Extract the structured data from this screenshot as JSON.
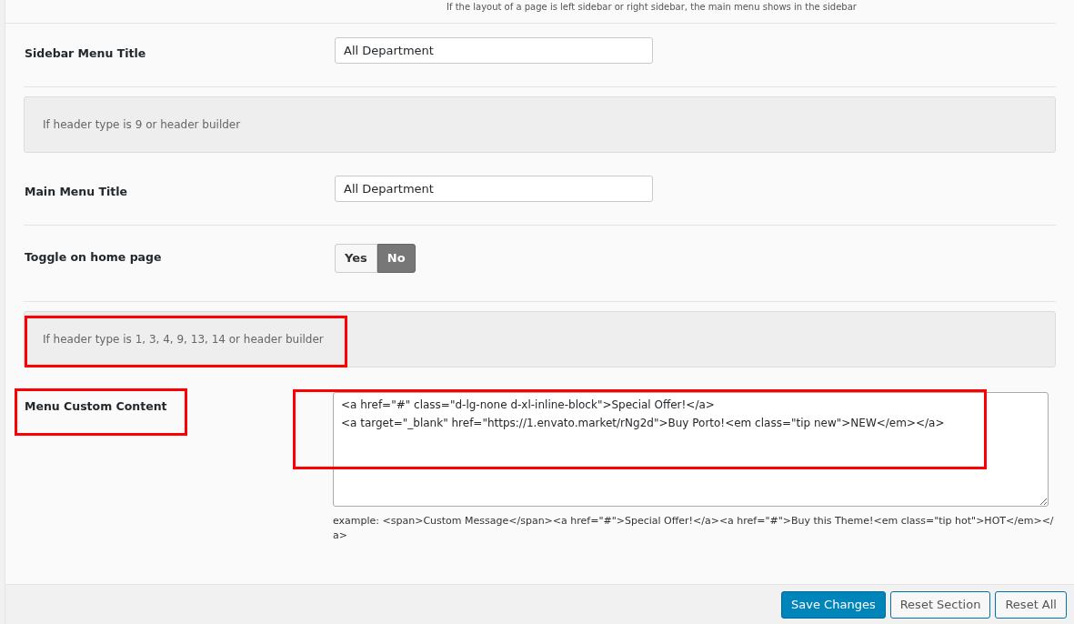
{
  "top_note": "If the layout of a page is left sidebar or right sidebar, the main menu shows in the sidebar",
  "fields": [
    {
      "kind": "text",
      "label": "Sidebar Menu Title",
      "value": "All Department"
    },
    {
      "kind": "info",
      "text": "If header type is 9 or header builder"
    },
    {
      "kind": "text",
      "label": "Main Menu Title",
      "value": "All Department"
    },
    {
      "kind": "toggle",
      "label": "Toggle on home page",
      "options": [
        {
          "label": "Yes",
          "selected": false
        },
        {
          "label": "No",
          "selected": true
        }
      ]
    },
    {
      "kind": "info",
      "text": "If header type is 1, 3, 4, 9, 13, 14 or header builder"
    },
    {
      "kind": "textarea",
      "label": "Menu Custom Content",
      "value": "<a href=\"#\" class=\"d-lg-none d-xl-inline-block\">Special Offer!</a>\n<a target=\"_blank\" href=\"https://1.envato.market/rNg2d\">Buy Porto!<em class=\"tip new\">NEW</em></a>",
      "description": "example: <span>Custom Message</span><a href=\"#\">Special Offer!</a><a href=\"#\">Buy this Theme!<em class=\"tip hot\">HOT</em></a>"
    }
  ],
  "buttons": [
    {
      "kind": "primary",
      "label": "Save Changes"
    },
    {
      "kind": "secondary",
      "label": "Reset Section"
    },
    {
      "kind": "secondary",
      "label": "Reset All"
    }
  ]
}
